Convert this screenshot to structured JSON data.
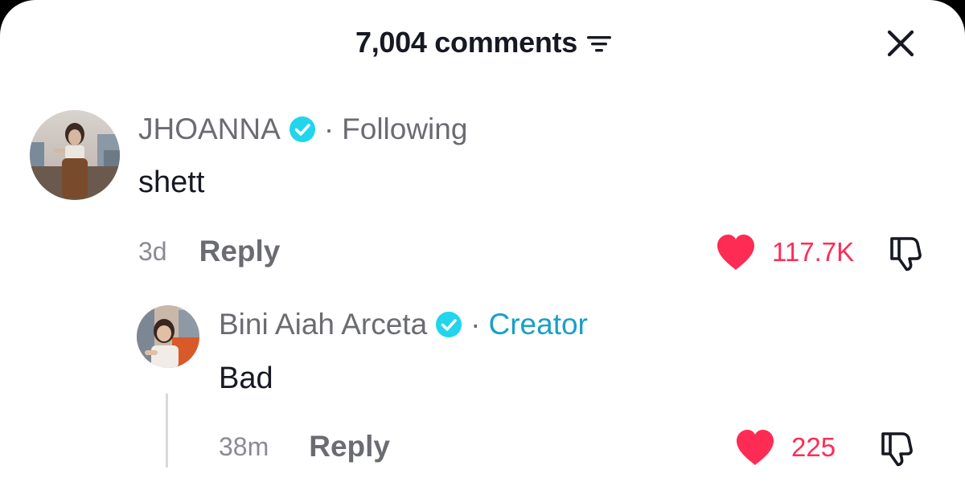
{
  "header": {
    "title": "7,004 comments",
    "sort_icon": "sort-lines-icon",
    "close_icon": "close-icon"
  },
  "comments": [
    {
      "username": "JHOANNA",
      "verified": true,
      "separator": "·",
      "tag": "Following",
      "text": "shett",
      "time": "3d",
      "reply_label": "Reply",
      "likes": "117.7K"
    },
    {
      "username": "Bini Aiah Arceta",
      "verified": true,
      "separator": "·",
      "tag": "Creator",
      "text": "Bad",
      "time": "38m",
      "reply_label": "Reply",
      "likes": "225"
    }
  ],
  "colors": {
    "like_red": "#fe2c55",
    "creator_teal": "#1a9fc7",
    "verified_blue": "#20d5ec",
    "text_dark": "#161823",
    "text_gray": "#6b6c72"
  }
}
